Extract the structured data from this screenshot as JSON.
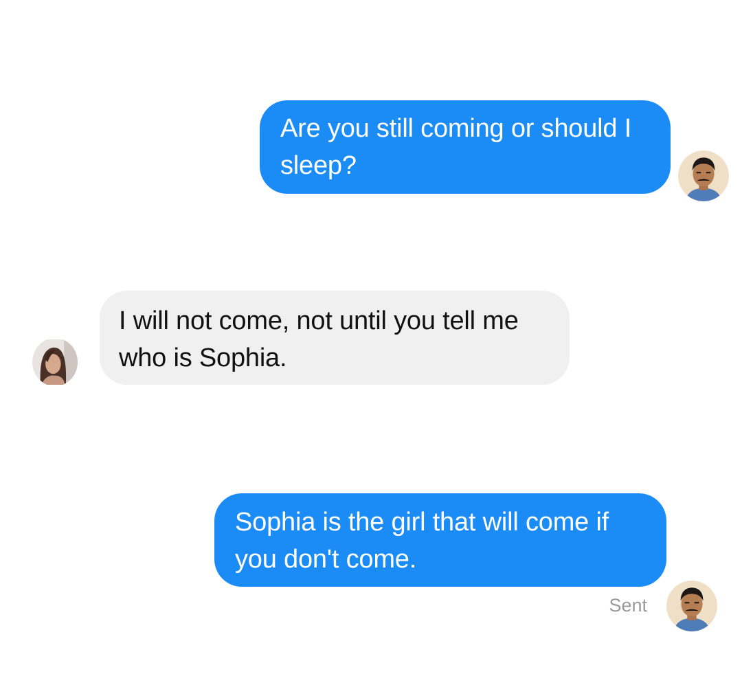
{
  "conversation": {
    "messages": [
      {
        "direction": "outgoing",
        "text": "Are you still coming or should I sleep?"
      },
      {
        "direction": "incoming",
        "text": "I will not come, not until you tell me who is Sophia."
      },
      {
        "direction": "outgoing",
        "text": "Sophia is the girl that will come if you don't come."
      }
    ],
    "status_label": "Sent"
  },
  "colors": {
    "outgoing_bubble": "#1b8cf6",
    "incoming_bubble": "#f0f0f0",
    "status_text": "#9a9a9a"
  },
  "icons": {
    "sender_avatar": "man-avatar-photo",
    "recipient_avatar": "woman-avatar-photo"
  }
}
